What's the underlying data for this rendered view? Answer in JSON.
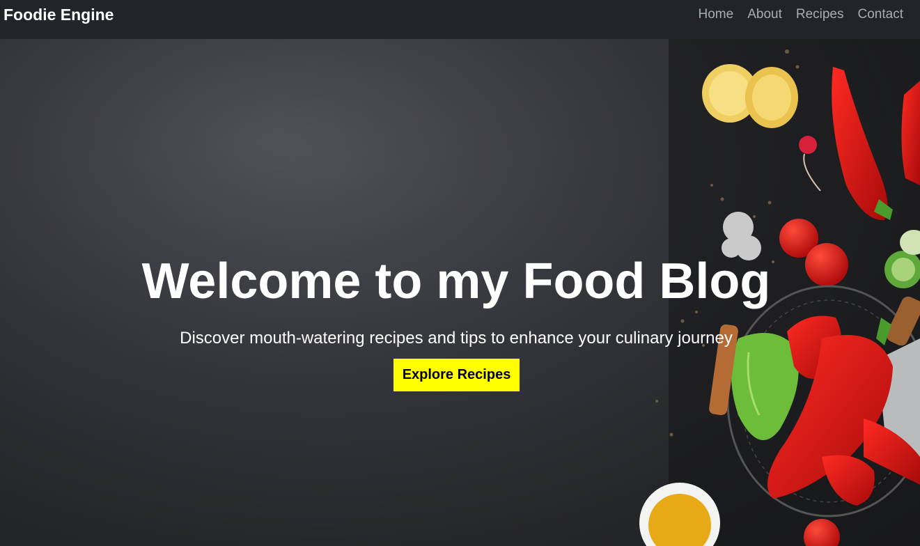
{
  "nav": {
    "brand": "Foodie Engine",
    "links": [
      "Home",
      "About",
      "Recipes",
      "Contact"
    ]
  },
  "hero": {
    "title": "Welcome to my Food Blog",
    "subtitle": "Discover mouth-watering recipes and tips to enhance your culinary journey",
    "cta_label": "Explore Recipes"
  },
  "colors": {
    "navbar_bg": "#212428",
    "nav_link": "#a9adb3",
    "cta_bg": "#ffff00",
    "hero_text": "#ffffff"
  }
}
